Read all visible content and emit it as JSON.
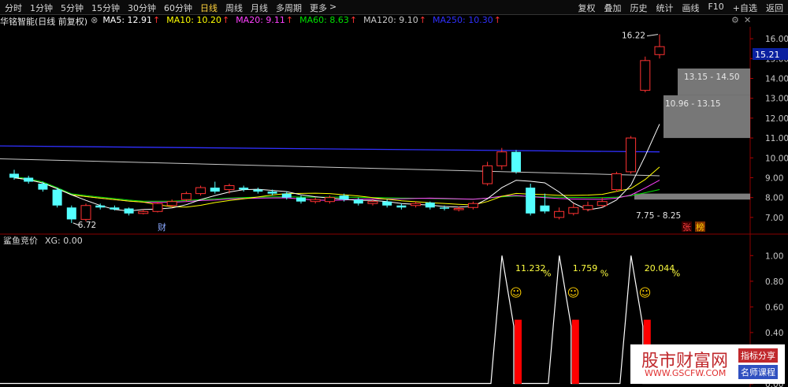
{
  "toolbar": {
    "periods": [
      "分时",
      "1分钟",
      "5分钟",
      "15分钟",
      "30分钟",
      "60分钟",
      "日线",
      "周线",
      "月线",
      "多周期",
      "更多"
    ],
    "active_period": "日线",
    "actions": [
      "复权",
      "叠加",
      "历史",
      "统计",
      "画线",
      "F10",
      "+自选",
      "返回"
    ],
    "more_arrow": ">"
  },
  "info": {
    "stock_name": "华铭智能(日线 前复权)",
    "dropdown_glyph": "⊗",
    "ma_labels": [
      {
        "text": "MA5: 12.91",
        "color": "#ffffff"
      },
      {
        "text": "MA10: 10.20",
        "color": "#ffff00"
      },
      {
        "text": "MA20: 9.11",
        "color": "#ff40ff"
      },
      {
        "text": "MA60: 8.63",
        "color": "#00e000"
      },
      {
        "text": "MA120: 9.10",
        "color": "#c8c8c8"
      },
      {
        "text": "MA250: 10.30",
        "color": "#3030ff"
      }
    ],
    "up_arrow": "↑"
  },
  "colors": {
    "up": "#ff3232",
    "down": "#54ffff",
    "ma5": "#ffffff",
    "ma10": "#ffff00",
    "ma20": "#ff40ff",
    "ma60": "#00e000",
    "ma120": "#c8c8c8",
    "ma250": "#3030ff",
    "bar": "#ff0000",
    "grid": "#7a0000"
  },
  "chart_data": [
    {
      "type": "candlestick",
      "title": "",
      "ylim": [
        6.2,
        16.6
      ],
      "y_ticks": [
        "16.00",
        "15.00",
        "14.00",
        "13.00",
        "12.00",
        "11.00",
        "10.00",
        "9.00",
        "8.00",
        "7.00"
      ],
      "last_price": "15.21",
      "high_label": "16.22",
      "low_label": "6.72",
      "candles": [
        {
          "o": 9.2,
          "c": 9.0,
          "h": 9.4,
          "l": 8.9
        },
        {
          "o": 9.0,
          "c": 8.8,
          "h": 9.1,
          "l": 8.7
        },
        {
          "o": 8.7,
          "c": 8.4,
          "h": 8.8,
          "l": 8.3
        },
        {
          "o": 8.4,
          "c": 7.6,
          "h": 8.5,
          "l": 7.5
        },
        {
          "o": 7.5,
          "c": 6.9,
          "h": 7.6,
          "l": 6.72
        },
        {
          "o": 6.9,
          "c": 7.6,
          "h": 7.7,
          "l": 6.8
        },
        {
          "o": 7.6,
          "c": 7.5,
          "h": 7.7,
          "l": 7.4
        },
        {
          "o": 7.5,
          "c": 7.4,
          "h": 7.6,
          "l": 7.35
        },
        {
          "o": 7.45,
          "c": 7.2,
          "h": 7.5,
          "l": 7.1
        },
        {
          "o": 7.2,
          "c": 7.3,
          "h": 7.4,
          "l": 7.15
        },
        {
          "o": 7.3,
          "c": 7.7,
          "h": 7.8,
          "l": 7.25
        },
        {
          "o": 7.6,
          "c": 7.8,
          "h": 7.9,
          "l": 7.5
        },
        {
          "o": 7.9,
          "c": 8.2,
          "h": 8.3,
          "l": 7.8
        },
        {
          "o": 8.2,
          "c": 8.5,
          "h": 8.6,
          "l": 8.1
        },
        {
          "o": 8.5,
          "c": 8.3,
          "h": 8.8,
          "l": 8.2
        },
        {
          "o": 8.4,
          "c": 8.6,
          "h": 8.7,
          "l": 8.2
        },
        {
          "o": 8.5,
          "c": 8.4,
          "h": 8.6,
          "l": 8.3
        },
        {
          "o": 8.4,
          "c": 8.3,
          "h": 8.5,
          "l": 8.2
        },
        {
          "o": 8.3,
          "c": 8.2,
          "h": 8.4,
          "l": 8.1
        },
        {
          "o": 8.2,
          "c": 8.0,
          "h": 8.3,
          "l": 7.9
        },
        {
          "o": 8.0,
          "c": 7.8,
          "h": 8.1,
          "l": 7.7
        },
        {
          "o": 7.8,
          "c": 7.9,
          "h": 8.0,
          "l": 7.7
        },
        {
          "o": 7.8,
          "c": 8.0,
          "h": 8.1,
          "l": 7.7
        },
        {
          "o": 8.1,
          "c": 7.9,
          "h": 8.2,
          "l": 7.8
        },
        {
          "o": 7.9,
          "c": 7.7,
          "h": 8.0,
          "l": 7.6
        },
        {
          "o": 7.7,
          "c": 7.8,
          "h": 7.9,
          "l": 7.6
        },
        {
          "o": 7.8,
          "c": 7.6,
          "h": 7.9,
          "l": 7.5
        },
        {
          "o": 7.6,
          "c": 7.5,
          "h": 7.7,
          "l": 7.4
        },
        {
          "o": 7.6,
          "c": 7.7,
          "h": 7.8,
          "l": 7.5
        },
        {
          "o": 7.75,
          "c": 7.5,
          "h": 7.8,
          "l": 7.4
        },
        {
          "o": 7.5,
          "c": 7.45,
          "h": 7.6,
          "l": 7.35
        },
        {
          "o": 7.4,
          "c": 7.45,
          "h": 7.55,
          "l": 7.3
        },
        {
          "o": 7.5,
          "c": 7.7,
          "h": 7.8,
          "l": 7.4
        },
        {
          "o": 8.7,
          "c": 9.6,
          "h": 9.8,
          "l": 8.6
        },
        {
          "o": 9.6,
          "c": 10.3,
          "h": 10.5,
          "l": 9.4
        },
        {
          "o": 10.3,
          "c": 9.3,
          "h": 10.4,
          "l": 9.2
        },
        {
          "o": 8.5,
          "c": 7.2,
          "h": 8.7,
          "l": 7.1
        },
        {
          "o": 7.6,
          "c": 7.3,
          "h": 8.2,
          "l": 7.2
        },
        {
          "o": 7.0,
          "c": 7.3,
          "h": 7.5,
          "l": 6.9
        },
        {
          "o": 7.2,
          "c": 7.5,
          "h": 7.7,
          "l": 7.1
        },
        {
          "o": 7.4,
          "c": 7.6,
          "h": 7.8,
          "l": 7.3
        },
        {
          "o": 7.6,
          "c": 7.8,
          "h": 8.0,
          "l": 7.5
        },
        {
          "o": 8.4,
          "c": 9.2,
          "h": 9.3,
          "l": 8.3
        },
        {
          "o": 9.3,
          "c": 11.0,
          "h": 11.1,
          "l": 9.2
        },
        {
          "o": 13.4,
          "c": 14.9,
          "h": 15.1,
          "l": 13.3
        },
        {
          "o": 15.2,
          "c": 15.6,
          "h": 16.22,
          "l": 15.0
        }
      ],
      "price_ranges": [
        {
          "label": "13.15 - 14.50",
          "from": 13.15,
          "to": 14.5
        },
        {
          "label": "10.96 - 13.15",
          "from": 10.96,
          "to": 13.15
        },
        {
          "label": "7.75 - 8.25",
          "from": 7.75,
          "to": 8.25
        }
      ],
      "grey_zones": [
        {
          "from": 13.15,
          "to": 14.5
        },
        {
          "from": 11.0,
          "to": 13.15
        },
        {
          "from": 7.9,
          "to": 8.2
        }
      ],
      "markers": {
        "cai": "财",
        "zhang": "张",
        "bang": "榜"
      },
      "ma250_endpoints": [
        10.6,
        10.3
      ],
      "ma120_endpoints": [
        9.95,
        9.1
      ]
    },
    {
      "type": "bar",
      "title": "鲨鱼竞价",
      "value_label": "XG: 0.00",
      "ylim": [
        0,
        1.1
      ],
      "y_ticks": [
        "1.00",
        "0.80",
        "0.60",
        "0.40",
        "0.20",
        "0.00"
      ],
      "spikes": [
        {
          "bar": 35,
          "bar_value": 0.5,
          "label": "11.232",
          "unit": "%"
        },
        {
          "bar": 39,
          "bar_value": 0.5,
          "label": "1.759",
          "unit": "%"
        },
        {
          "bar": 44,
          "bar_value": 0.5,
          "label": "20.044",
          "unit": "%"
        }
      ],
      "smile": "☺"
    }
  ],
  "watermark": {
    "site_name": "股市财富网",
    "url": "WWW.GSCFW.COM",
    "tag1": "指标分享",
    "tag2": "名师课程"
  }
}
